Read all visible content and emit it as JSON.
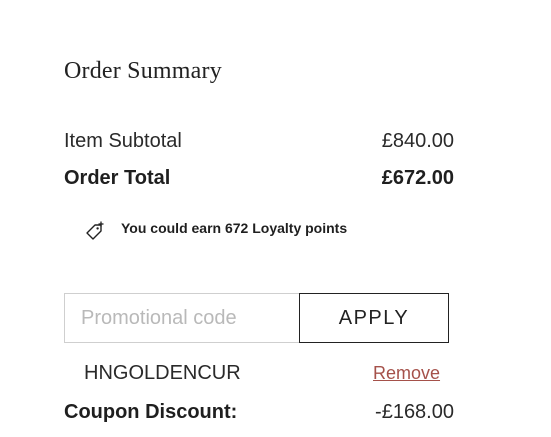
{
  "order_summary": {
    "title": "Order Summary",
    "item_subtotal_label": "Item Subtotal",
    "item_subtotal_value": "£840.00",
    "order_total_label": "Order Total",
    "order_total_value": "£672.00"
  },
  "loyalty": {
    "icon": "tag-plus-icon",
    "text": "You could earn 672 Loyalty points"
  },
  "promo": {
    "placeholder": "Promotional code",
    "value": "",
    "apply_label": "APPLY"
  },
  "coupon": {
    "code": "HNGOLDENCUR",
    "remove_label": "Remove",
    "discount_label": "Coupon Discount:",
    "discount_value": "-£168.00"
  },
  "colors": {
    "text": "#222222",
    "border_light": "#cfcfcf",
    "remove_link": "#a5514a"
  }
}
